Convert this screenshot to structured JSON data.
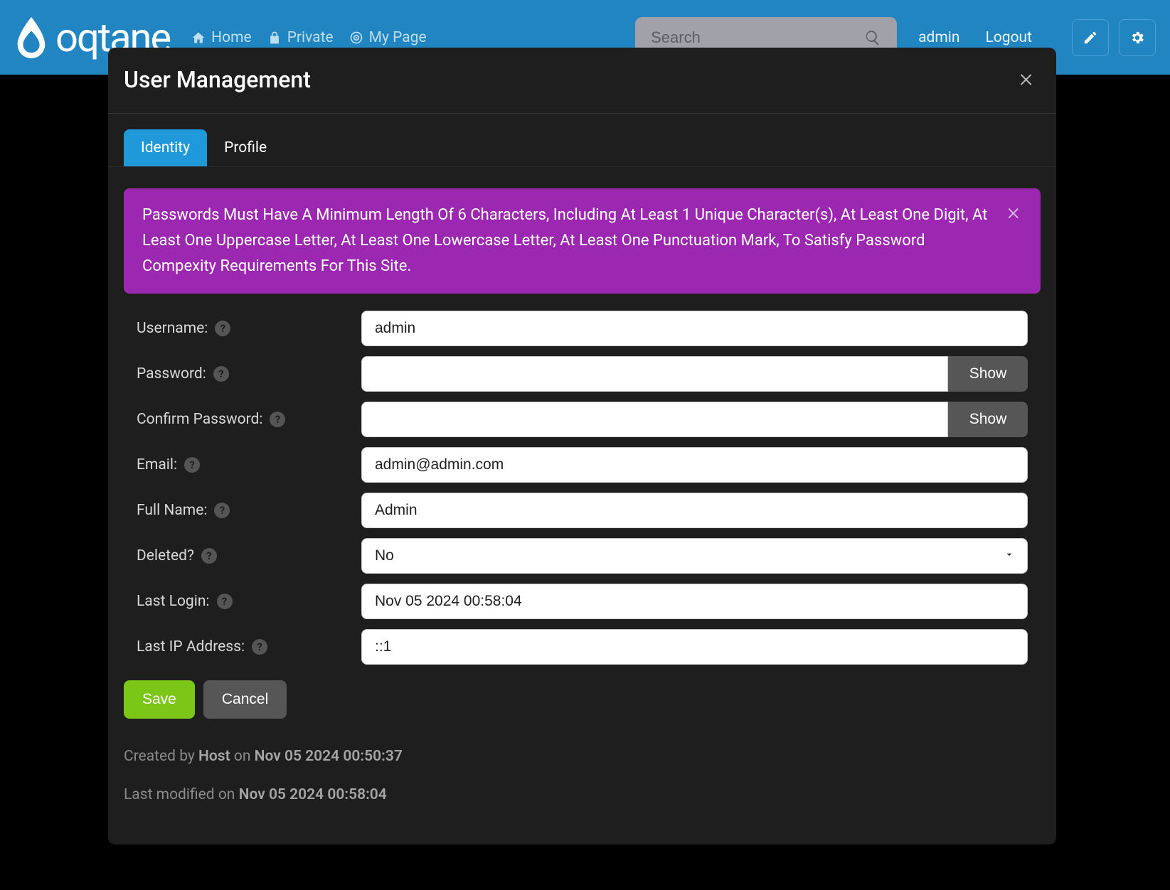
{
  "logo_text": "oqtane",
  "nav": {
    "home": "Home",
    "private": "Private",
    "mypage": "My Page"
  },
  "search": {
    "placeholder": "Search"
  },
  "user_nav": {
    "username": "admin",
    "logout": "Logout"
  },
  "modal": {
    "title": "User Management",
    "tabs": {
      "identity": "Identity",
      "profile": "Profile"
    },
    "alert": "Passwords Must Have A Minimum Length Of 6 Characters, Including At Least 1 Unique Character(s), At Least One Digit, At Least One Uppercase Letter, At Least One Lowercase Letter, At Least One Punctuation Mark, To Satisfy Password Compexity Requirements For This Site."
  },
  "form": {
    "labels": {
      "username": "Username:",
      "password": "Password:",
      "confirm": "Confirm Password:",
      "email": "Email:",
      "fullname": "Full Name:",
      "deleted": "Deleted?",
      "lastlogin": "Last Login:",
      "lastip": "Last IP Address:"
    },
    "values": {
      "username": "admin",
      "password": "",
      "confirm": "",
      "email": "admin@admin.com",
      "fullname": "Admin",
      "deleted": "No",
      "lastlogin": "Nov 05 2024 00:58:04",
      "lastip": "::1"
    },
    "show_label": "Show"
  },
  "buttons": {
    "save": "Save",
    "cancel": "Cancel"
  },
  "audit": {
    "created_prefix": "Created by ",
    "created_by": "Host",
    "created_mid": " on ",
    "created_on": "Nov 05 2024 00:50:37",
    "modified_prefix": "Last modified on ",
    "modified_on": "Nov 05 2024 00:58:04"
  }
}
